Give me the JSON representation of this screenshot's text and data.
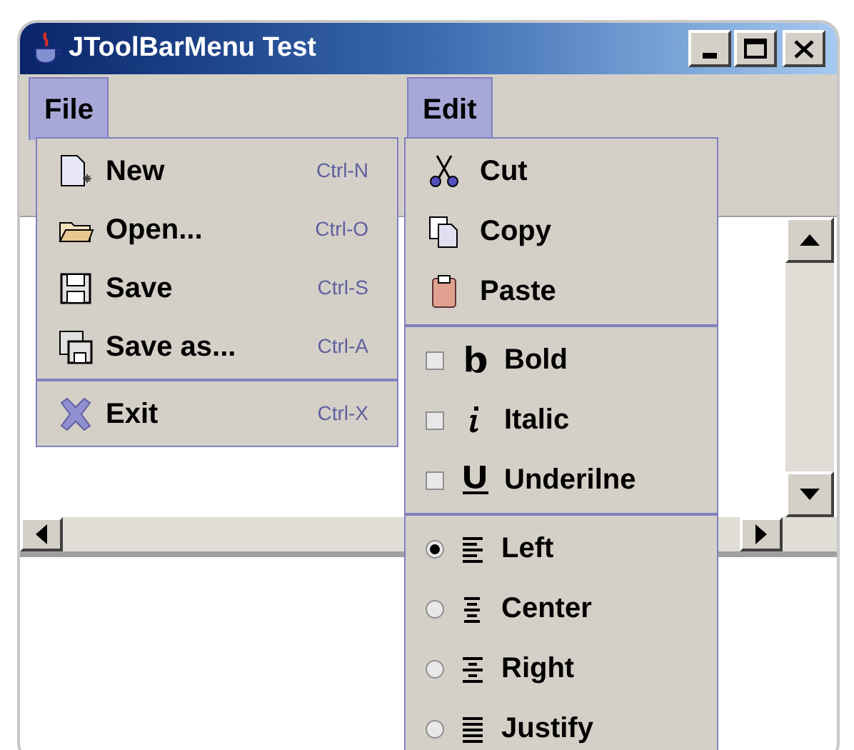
{
  "window": {
    "title": "JToolBarMenu Test"
  },
  "menu_bar": [
    {
      "label": "File",
      "selected": true
    },
    {
      "label": "Edit",
      "selected": true
    }
  ],
  "file_menu": {
    "groups": [
      {
        "items": [
          {
            "label": "New",
            "shortcut": "Ctrl-N"
          },
          {
            "label": "Open...",
            "shortcut": "Ctrl-O"
          },
          {
            "label": "Save",
            "shortcut": "Ctrl-S"
          },
          {
            "label": "Save as...",
            "shortcut": "Ctrl-A"
          }
        ]
      },
      {
        "items": [
          {
            "label": "Exit",
            "shortcut": "Ctrl-X"
          }
        ]
      }
    ]
  },
  "edit_menu": {
    "groups": [
      {
        "items": [
          {
            "kind": "action",
            "label": "Cut"
          },
          {
            "kind": "action",
            "label": "Copy"
          },
          {
            "kind": "action",
            "label": "Paste"
          }
        ]
      },
      {
        "items": [
          {
            "kind": "check",
            "label": "Bold",
            "checked": false
          },
          {
            "kind": "check",
            "label": "Italic",
            "checked": false
          },
          {
            "kind": "check",
            "label": "Underilne",
            "checked": false
          }
        ]
      },
      {
        "items": [
          {
            "kind": "radio",
            "label": "Left",
            "selected": true
          },
          {
            "kind": "radio",
            "label": "Center",
            "selected": false
          },
          {
            "kind": "radio",
            "label": "Right",
            "selected": false
          },
          {
            "kind": "radio",
            "label": "Justify",
            "selected": false
          }
        ]
      }
    ]
  }
}
